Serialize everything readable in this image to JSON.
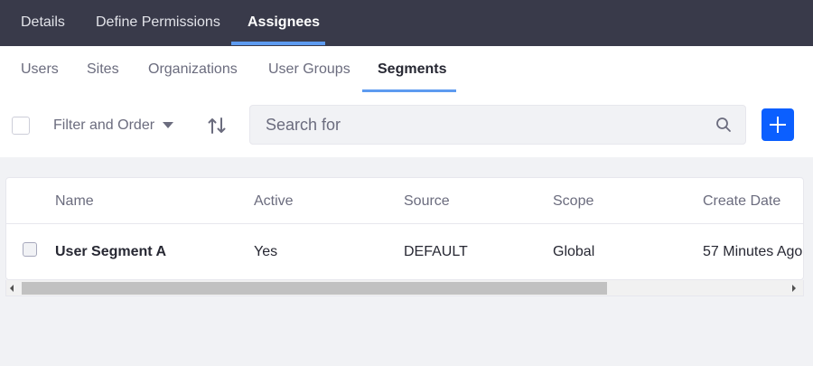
{
  "top_nav": {
    "tabs": [
      {
        "label": "Details",
        "active": false
      },
      {
        "label": "Define Permissions",
        "active": false
      },
      {
        "label": "Assignees",
        "active": true
      }
    ]
  },
  "sub_nav": {
    "tabs": [
      {
        "label": "Users",
        "active": false
      },
      {
        "label": "Sites",
        "active": false
      },
      {
        "label": "Organizations",
        "active": false
      },
      {
        "label": "User Groups",
        "active": false
      },
      {
        "label": "Segments",
        "active": true
      }
    ]
  },
  "toolbar": {
    "filter_label": "Filter and Order",
    "search_placeholder": "Search for",
    "search_value": "",
    "add_icon": "plus-icon",
    "sort_icon": "sort-arrows-icon",
    "search_icon": "magnifier-icon"
  },
  "table": {
    "columns": [
      "Name",
      "Active",
      "Source",
      "Scope",
      "Create Date"
    ],
    "rows": [
      {
        "name": "User Segment A",
        "active": "Yes",
        "source": "DEFAULT",
        "scope": "Global",
        "create_date": "57 Minutes Ago"
      }
    ]
  },
  "colors": {
    "top_nav_bg": "#393a4a",
    "accent": "#5d9bf0",
    "primary_button": "#0b5fff",
    "page_bg": "#f1f2f5"
  }
}
